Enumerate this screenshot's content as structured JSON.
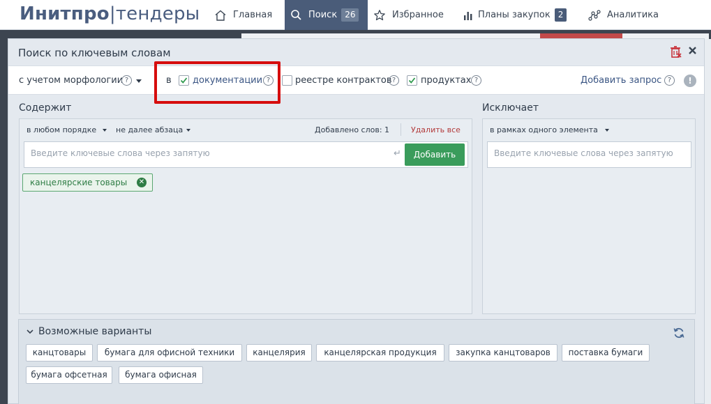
{
  "app": {
    "logo_brand": "Инитпро",
    "logo_sep": "|",
    "logo_rest": "тендеры"
  },
  "nav": {
    "home": "Главная",
    "search": "Поиск",
    "search_count": "26",
    "favorites": "Избранное",
    "plans": "Планы закупок",
    "plans_count": "2",
    "analytics": "Аналитика"
  },
  "modal": {
    "title": "Поиск по ключевым словам",
    "trash_icon": "trash-icon",
    "close_icon": "close-icon"
  },
  "options": {
    "morphology": "с учетом морфологии",
    "in_label": "в",
    "documentation": "документации",
    "documentation_checked": true,
    "registry": "реестре контрактов",
    "registry_checked": false,
    "products": "продуктах",
    "products_checked": true,
    "add_query": "Добавить запрос",
    "help_glyph": "?",
    "warn_glyph": "!"
  },
  "contains": {
    "title": "Содержит",
    "order": "в любом порядке",
    "distance": "не далее абзаца",
    "added_words": "Добавлено слов: 1",
    "delete_all": "Удалить все",
    "placeholder": "Введите ключевые слова через запятую",
    "enter_glyph": "↵",
    "add_button": "Добавить",
    "chips": [
      {
        "label": "канцелярские товары",
        "remove": "✕"
      }
    ]
  },
  "excludes": {
    "title": "Исключает",
    "scope": "в рамках одного элемента",
    "placeholder": "Введите ключевые слова через запятую"
  },
  "variants": {
    "title": "Возможные варианты",
    "tags": [
      "канцтовары",
      "бумага для офисной техники",
      "канцелярия",
      "канцелярская продукция",
      "закупка канцтоваров",
      "поставка бумаги",
      "бумага офсетная",
      "бумага офисная"
    ]
  },
  "colors": {
    "nav_active": "#4a5c79",
    "accent_green": "#3a9c5b",
    "highlight_red": "#d60d0d",
    "delete_red": "#b23a3a"
  }
}
